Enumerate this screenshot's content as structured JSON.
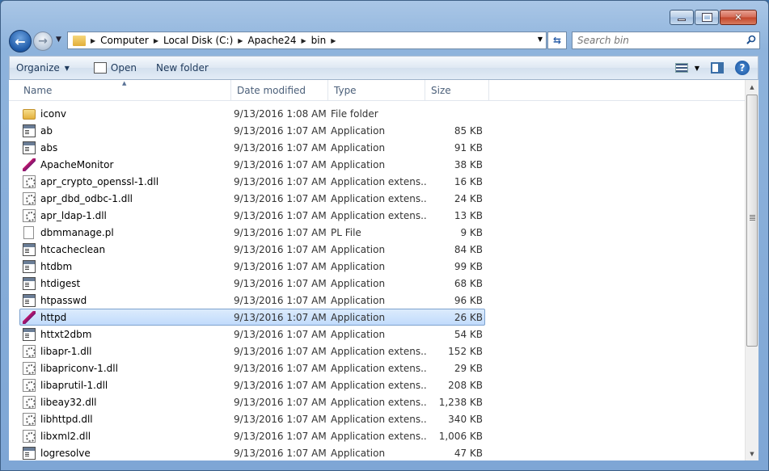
{
  "window": {
    "caption_buttons": [
      "minimize",
      "maximize",
      "close"
    ]
  },
  "nav": {
    "breadcrumbs": [
      "Computer",
      "Local Disk (C:)",
      "Apache24",
      "bin"
    ],
    "search_placeholder": "Search bin"
  },
  "toolbar": {
    "organize_label": "Organize",
    "open_label": "Open",
    "new_folder_label": "New folder"
  },
  "columns": {
    "name": "Name",
    "date": "Date modified",
    "type": "Type",
    "size": "Size"
  },
  "files": [
    {
      "name": "iconv",
      "date": "9/13/2016 1:08 AM",
      "type": "File folder",
      "size": "",
      "icon": "folder-icon"
    },
    {
      "name": "ab",
      "date": "9/13/2016 1:07 AM",
      "type": "Application",
      "size": "85 KB",
      "icon": "application-icon"
    },
    {
      "name": "abs",
      "date": "9/13/2016 1:07 AM",
      "type": "Application",
      "size": "91 KB",
      "icon": "application-icon"
    },
    {
      "name": "ApacheMonitor",
      "date": "9/13/2016 1:07 AM",
      "type": "Application",
      "size": "38 KB",
      "icon": "apache-feather-icon"
    },
    {
      "name": "apr_crypto_openssl-1.dll",
      "date": "9/13/2016 1:07 AM",
      "type": "Application extens...",
      "size": "16 KB",
      "icon": "dll-icon"
    },
    {
      "name": "apr_dbd_odbc-1.dll",
      "date": "9/13/2016 1:07 AM",
      "type": "Application extens...",
      "size": "24 KB",
      "icon": "dll-icon"
    },
    {
      "name": "apr_ldap-1.dll",
      "date": "9/13/2016 1:07 AM",
      "type": "Application extens...",
      "size": "13 KB",
      "icon": "dll-icon"
    },
    {
      "name": "dbmmanage.pl",
      "date": "9/13/2016 1:07 AM",
      "type": "PL File",
      "size": "9 KB",
      "icon": "file-icon"
    },
    {
      "name": "htcacheclean",
      "date": "9/13/2016 1:07 AM",
      "type": "Application",
      "size": "84 KB",
      "icon": "application-icon"
    },
    {
      "name": "htdbm",
      "date": "9/13/2016 1:07 AM",
      "type": "Application",
      "size": "99 KB",
      "icon": "application-icon"
    },
    {
      "name": "htdigest",
      "date": "9/13/2016 1:07 AM",
      "type": "Application",
      "size": "68 KB",
      "icon": "application-icon"
    },
    {
      "name": "htpasswd",
      "date": "9/13/2016 1:07 AM",
      "type": "Application",
      "size": "96 KB",
      "icon": "application-icon"
    },
    {
      "name": "httpd",
      "date": "9/13/2016 1:07 AM",
      "type": "Application",
      "size": "26 KB",
      "icon": "apache-feather-icon",
      "selected": true
    },
    {
      "name": "httxt2dbm",
      "date": "9/13/2016 1:07 AM",
      "type": "Application",
      "size": "54 KB",
      "icon": "application-icon"
    },
    {
      "name": "libapr-1.dll",
      "date": "9/13/2016 1:07 AM",
      "type": "Application extens...",
      "size": "152 KB",
      "icon": "dll-icon"
    },
    {
      "name": "libapriconv-1.dll",
      "date": "9/13/2016 1:07 AM",
      "type": "Application extens...",
      "size": "29 KB",
      "icon": "dll-icon"
    },
    {
      "name": "libaprutil-1.dll",
      "date": "9/13/2016 1:07 AM",
      "type": "Application extens...",
      "size": "208 KB",
      "icon": "dll-icon"
    },
    {
      "name": "libeay32.dll",
      "date": "9/13/2016 1:07 AM",
      "type": "Application extens...",
      "size": "1,238 KB",
      "icon": "dll-icon"
    },
    {
      "name": "libhttpd.dll",
      "date": "9/13/2016 1:07 AM",
      "type": "Application extens...",
      "size": "340 KB",
      "icon": "dll-icon"
    },
    {
      "name": "libxml2.dll",
      "date": "9/13/2016 1:07 AM",
      "type": "Application extens...",
      "size": "1,006 KB",
      "icon": "dll-icon"
    },
    {
      "name": "logresolve",
      "date": "9/13/2016 1:07 AM",
      "type": "Application",
      "size": "47 KB",
      "icon": "application-icon"
    }
  ],
  "colors": {
    "selection_bg": "#c8e0fc",
    "selection_border": "#7da2ce",
    "frame": "#8eb3dc"
  }
}
